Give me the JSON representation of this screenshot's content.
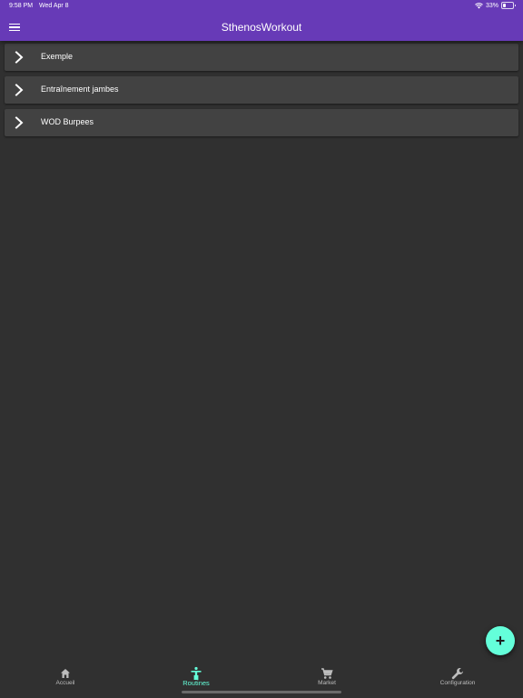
{
  "status_bar": {
    "time": "9:58 PM",
    "date": "Wed Apr 8",
    "battery": "33%",
    "battery_level": 0.33
  },
  "app_bar": {
    "title": "SthenosWorkout",
    "menu_icon": "hamburger-menu-icon"
  },
  "routines": [
    {
      "label": "Exemple",
      "icon": "chevron-right-icon"
    },
    {
      "label": "Entraînement jambes",
      "icon": "chevron-right-icon"
    },
    {
      "label": "WOD Burpees",
      "icon": "chevron-right-icon"
    }
  ],
  "fab": {
    "icon": "add-icon",
    "color": "#64ffda"
  },
  "bottom_nav": {
    "active": "Routines",
    "tabs": [
      {
        "label": "Accueil",
        "icon": "home-icon"
      },
      {
        "label": "Routines",
        "icon": "person-icon"
      },
      {
        "label": "Market",
        "icon": "shopping-cart-icon"
      },
      {
        "label": "Configuration",
        "icon": "wrench-icon"
      }
    ]
  },
  "colors": {
    "app_bar": "#673ab7",
    "accent": "#64ffda",
    "background": "#303030",
    "card": "#424242"
  }
}
